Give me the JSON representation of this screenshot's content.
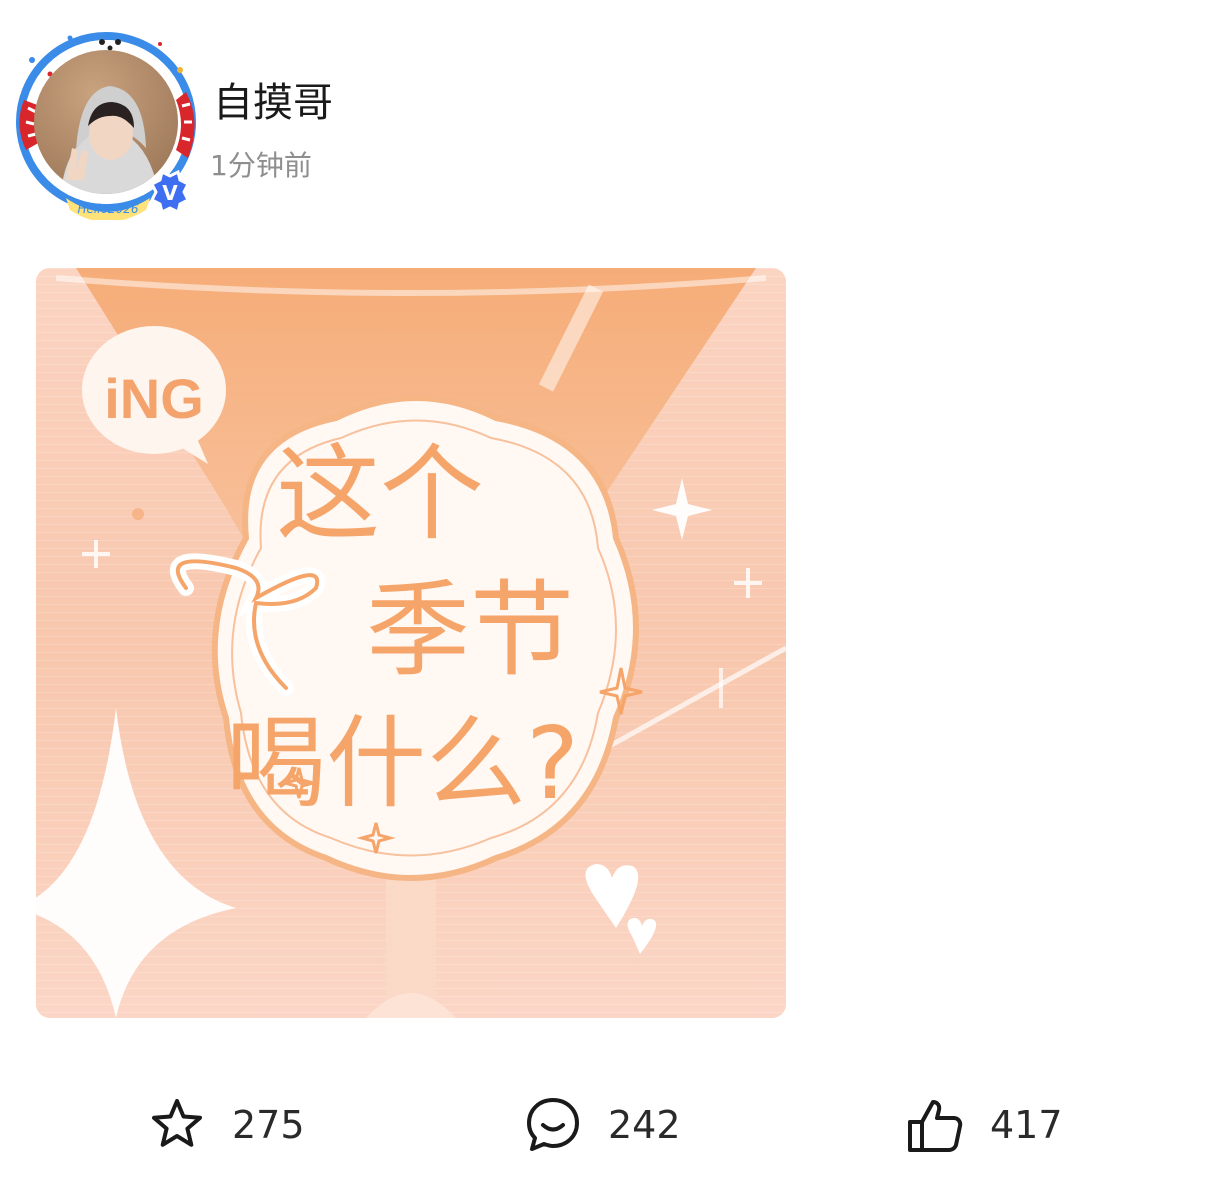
{
  "post": {
    "author": {
      "name": "自摸哥",
      "avatar_frame_text": "Hello2026",
      "verified_badge": "V"
    },
    "time": "1分钟前",
    "image": {
      "logo_text": "iNG",
      "headline_line1": "这个",
      "headline_line2": "季节",
      "headline_line3": "喝什么?"
    }
  },
  "actions": {
    "favorite": {
      "icon": "star-outline-icon",
      "count": "275"
    },
    "comment": {
      "icon": "chat-bubble-icon",
      "count": "242"
    },
    "like": {
      "icon": "thumbs-up-icon",
      "count": "417"
    }
  },
  "colors": {
    "poster_bg": "#f8cbb3",
    "poster_accent": "#f3a36b",
    "verified_blue": "#3d6ff0",
    "frame_red": "#d8262b",
    "frame_blue": "#3b8be8"
  }
}
